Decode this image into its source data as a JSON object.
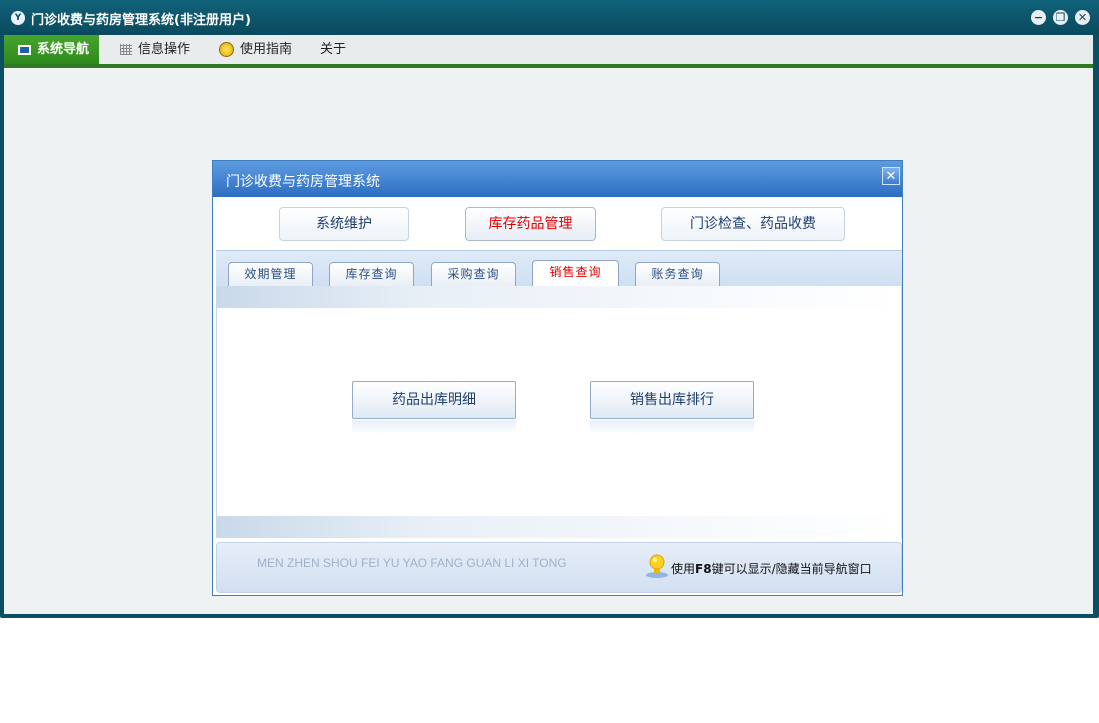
{
  "window": {
    "title": "门诊收费与药房管理系统(非注册用户)",
    "app_icon": "Y"
  },
  "menubar": {
    "items": [
      {
        "label": "系统导航",
        "icon": "monitor-icon",
        "active": true
      },
      {
        "label": "信息操作",
        "icon": "grid-icon",
        "active": false
      },
      {
        "label": "使用指南",
        "icon": "guide-icon",
        "active": false
      },
      {
        "label": "关于",
        "icon": "",
        "active": false
      }
    ]
  },
  "dialog": {
    "title": "门诊收费与药房管理系统",
    "main_buttons": [
      {
        "label": "系统维护",
        "selected": false
      },
      {
        "label": "库存药品管理",
        "selected": true
      },
      {
        "label": "门诊检查、药品收费",
        "selected": false
      }
    ],
    "tabs": [
      {
        "label": "效期管理",
        "selected": false
      },
      {
        "label": "库存查询",
        "selected": false
      },
      {
        "label": "采购查询",
        "selected": false
      },
      {
        "label": "销售查询",
        "selected": true
      },
      {
        "label": "账务查询",
        "selected": false
      }
    ],
    "actions": [
      {
        "label": "药品出库明细"
      },
      {
        "label": "销售出库排行"
      }
    ],
    "footer": {
      "pinyin": "MEN ZHEN SHOU FEI YU YAO FANG GUAN LI XI TONG",
      "tip_prefix": "使用",
      "tip_key": "F8",
      "tip_suffix": "键可以显示/隐藏当前导航窗口"
    }
  },
  "colors": {
    "window_frame": "#0b4f63",
    "menu_active": "#3a9a25",
    "dialog_title": "#3f7fcf",
    "selected_text": "#e00000"
  }
}
